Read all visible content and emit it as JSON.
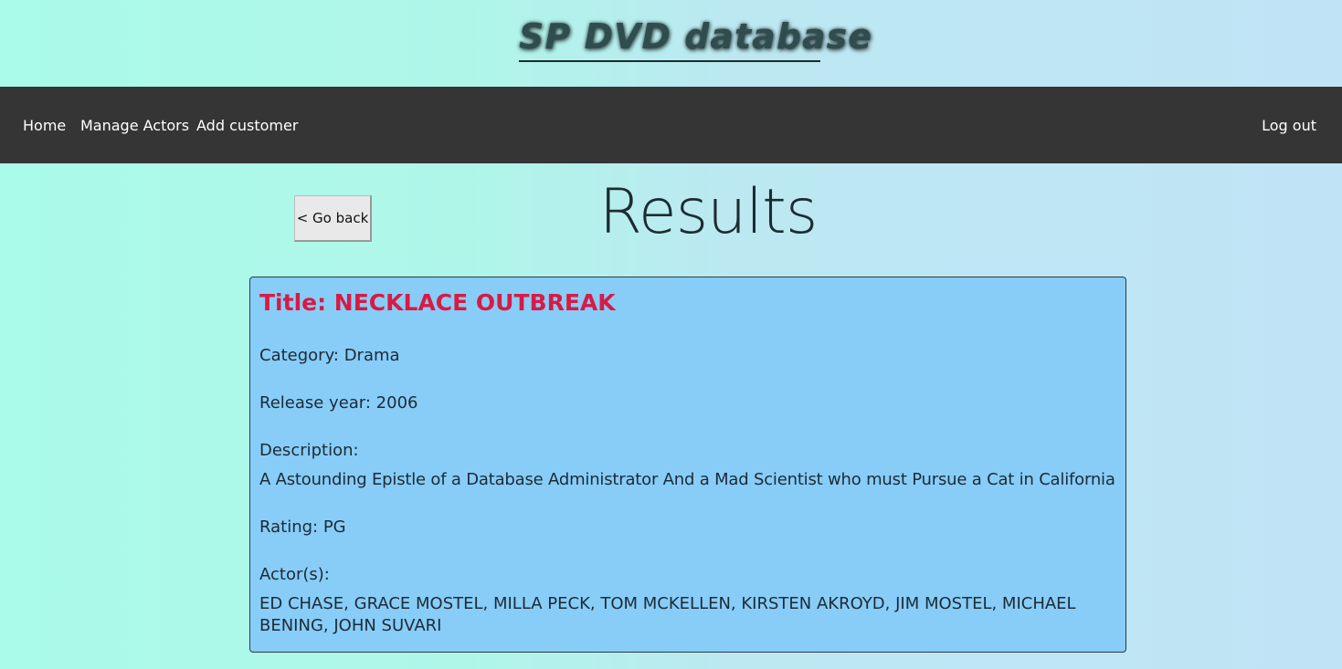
{
  "header": {
    "site_title": "SP DVD database"
  },
  "nav": {
    "home": "Home",
    "manage_actors": "Manage Actors",
    "add_customer": "Add customer",
    "logout": "Log out"
  },
  "page": {
    "go_back": "< Go back",
    "title": "Results"
  },
  "film": {
    "title": "Title: NECKLACE OUTBREAK",
    "category": "Category: Drama",
    "release_year": "Release year: 2006",
    "description_label": "Description:",
    "description": "A Astounding Epistle of a Database Administrator And a Mad Scientist who must Pursue a Cat in California",
    "rating": "Rating: PG",
    "actors_label": "Actor(s):",
    "actors": "ED CHASE, GRACE MOSTEL, MILLA PECK, TOM MCKELLEN, KIRSTEN AKROYD, JIM MOSTEL, MICHAEL BENING, JOHN SUVARI"
  },
  "colors": {
    "navbar_bg": "#353535",
    "card_bg": "#87cdf8",
    "title_accent": "#d81a45"
  }
}
